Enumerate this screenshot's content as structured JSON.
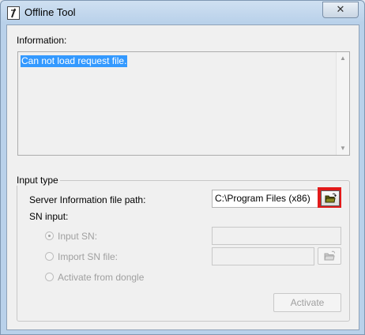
{
  "window": {
    "title": "Offline Tool",
    "close_glyph": "✕",
    "icon": "app-icon"
  },
  "information": {
    "label": "Information:",
    "message": "Can not load request file.",
    "scroll_up_glyph": "▲",
    "scroll_down_glyph": "▼"
  },
  "input_type": {
    "legend": "Input type",
    "server_path_label": "Server Information file path:",
    "server_path_value": "C:\\Program Files (x86)",
    "browse_icon": "folder-open-icon",
    "sn_input_label": "SN input:",
    "options": [
      {
        "label": "Input SN:",
        "selected": true,
        "enabled": false
      },
      {
        "label": "Import SN file:",
        "selected": false,
        "enabled": false
      },
      {
        "label": "Activate from dongle",
        "selected": false,
        "enabled": false
      }
    ],
    "input_sn_value": "",
    "import_sn_file_value": ""
  },
  "buttons": {
    "activate_label": "Activate"
  },
  "colors": {
    "selection": "#3399ff",
    "highlight_border": "#e11b1b",
    "disabled_text": "#a0a0a0"
  }
}
